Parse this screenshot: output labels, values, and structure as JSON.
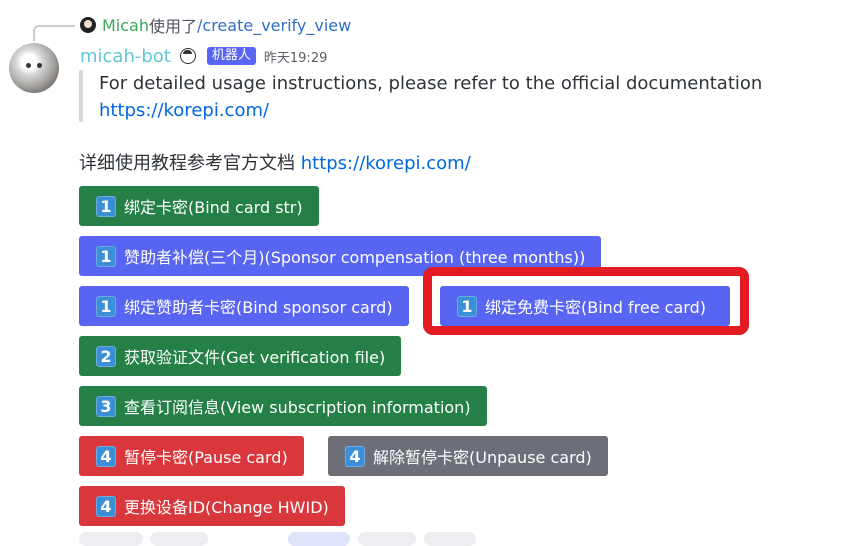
{
  "reply": {
    "user": "Micah",
    "text": "使用了",
    "command": "/create_verify_view"
  },
  "author": {
    "name": "micah-bot",
    "tag": "机器人",
    "timestamp": "昨天19:29"
  },
  "embed": {
    "description": "For detailed usage instructions, please refer to the official documentation",
    "url": "https://korepi.com/"
  },
  "content": {
    "text": "详细使用教程参考官方文档 ",
    "url": "https://korepi.com/"
  },
  "buttons": [
    {
      "key": "1",
      "label": "绑定卡密(Bind card str)",
      "style": "green"
    },
    {
      "key": "1",
      "label": "赞助者补偿(三个月)(Sponsor compensation (three months))",
      "style": "blurple"
    },
    {
      "key": "1",
      "label": "绑定赞助者卡密(Bind sponsor card)",
      "style": "blurple"
    },
    {
      "key": "1",
      "label": "绑定免费卡密(Bind free card)",
      "style": "blurple"
    },
    {
      "key": "2",
      "label": "获取验证文件(Get verification file)",
      "style": "green"
    },
    {
      "key": "3",
      "label": "查看订阅信息(View subscription information)",
      "style": "green"
    },
    {
      "key": "4",
      "label": "暂停卡密(Pause card)",
      "style": "red"
    },
    {
      "key": "4",
      "label": "解除暂停卡密(Unpause card)",
      "style": "gray"
    },
    {
      "key": "4",
      "label": "更换设备ID(Change HWID)",
      "style": "red"
    }
  ],
  "colors": {
    "green": "#248046",
    "blurple": "#5865f2",
    "red": "#da373c",
    "gray": "#6d6f78",
    "highlight": "#e21c22",
    "username": "#5fc7d3",
    "link": "#0068e0"
  }
}
